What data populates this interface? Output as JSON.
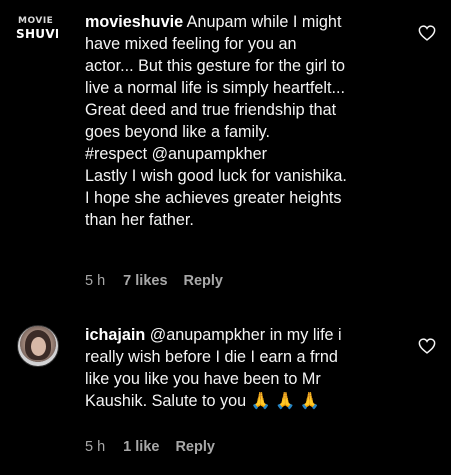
{
  "comments": [
    {
      "avatar": "movie-shuvie-logo",
      "logo_top": "MOVIE",
      "logo_bottom": "SHUVIE",
      "username": "movieshuvie",
      "text": " Anupam while I might\nhave mixed feeling for you an\nactor... But this gesture for the girl to\nlive a normal life is simply heartfelt...\nGreat deed and true friendship that\ngoes beyond like a family.\n#respect @anupampkher\nLastly I wish good luck for vanishika.\nI hope she achieves greater heights\nthan her father.",
      "time": "5 h",
      "likes": "7 likes",
      "reply": "Reply",
      "like_icon": "heart-outline-icon"
    },
    {
      "avatar": "user-photo",
      "username": "ichajain",
      "text": " @anupampkher in my life i\nreally wish before I die I earn a frnd\nlike you like you have been to Mr\nKaushik. Salute to you 🙏 🙏 🙏",
      "time": "5 h",
      "likes": "1 like",
      "reply": "Reply",
      "like_icon": "heart-outline-icon"
    }
  ],
  "colors": {
    "background": "#000000",
    "text": "#f5f5f5",
    "meta": "#a8a8a8"
  }
}
